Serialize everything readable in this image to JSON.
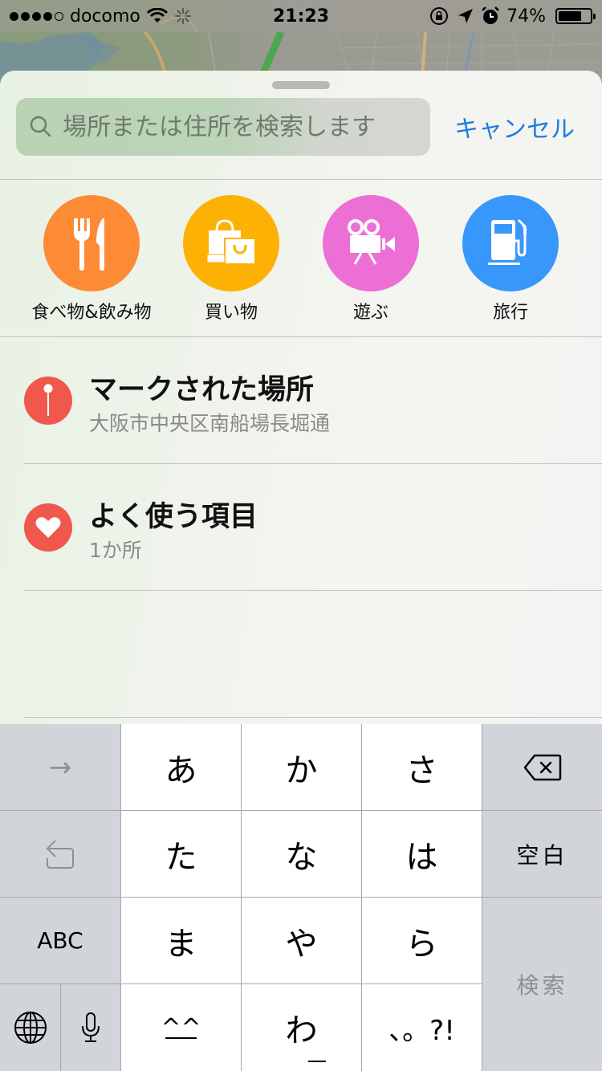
{
  "status_bar": {
    "signal_filled": 4,
    "signal_total": 5,
    "carrier": "docomo",
    "time": "21:23",
    "battery_percent_label": "74%",
    "battery_level": 0.74,
    "icons": [
      "wifi-icon",
      "activity-spinner-icon",
      "rotation-lock-icon",
      "location-arrow-icon",
      "alarm-icon",
      "battery-icon"
    ]
  },
  "search": {
    "placeholder": "場所または住所を検索します",
    "value": "",
    "cancel_label": "キャンセル"
  },
  "categories": [
    {
      "label": "食べ物&飲み物",
      "icon": "fork-knife-icon",
      "color": "#fd8a35"
    },
    {
      "label": "買い物",
      "icon": "shopping-bags-icon",
      "color": "#fdb104"
    },
    {
      "label": "遊ぶ",
      "icon": "movie-camera-icon",
      "color": "#ec6fd6"
    },
    {
      "label": "旅行",
      "icon": "gas-pump-icon",
      "color": "#3897fb"
    }
  ],
  "list": [
    {
      "title": "マークされた場所",
      "subtitle": "大阪市中央区南船場長堀通",
      "icon": "pin-icon"
    },
    {
      "title": "よく使う項目",
      "subtitle": "1か所",
      "icon": "heart-icon"
    }
  ],
  "keyboard": {
    "row1": {
      "left": "→",
      "keys": [
        "あ",
        "か",
        "さ"
      ],
      "right_icon": "delete-icon"
    },
    "row2": {
      "left_icon": "undo-icon",
      "keys": [
        "た",
        "な",
        "は"
      ],
      "right": "空白"
    },
    "row3": {
      "left": "ABC",
      "keys": [
        "ま",
        "や",
        "ら"
      ],
      "right": "検索"
    },
    "row4": {
      "left_icons": [
        "globe-icon",
        "microphone-icon"
      ],
      "keys": [
        "^^",
        "わ",
        "、。?!"
      ]
    }
  },
  "colors": {
    "accent": "#1a7ee0",
    "list_icon": "#f0584c"
  }
}
